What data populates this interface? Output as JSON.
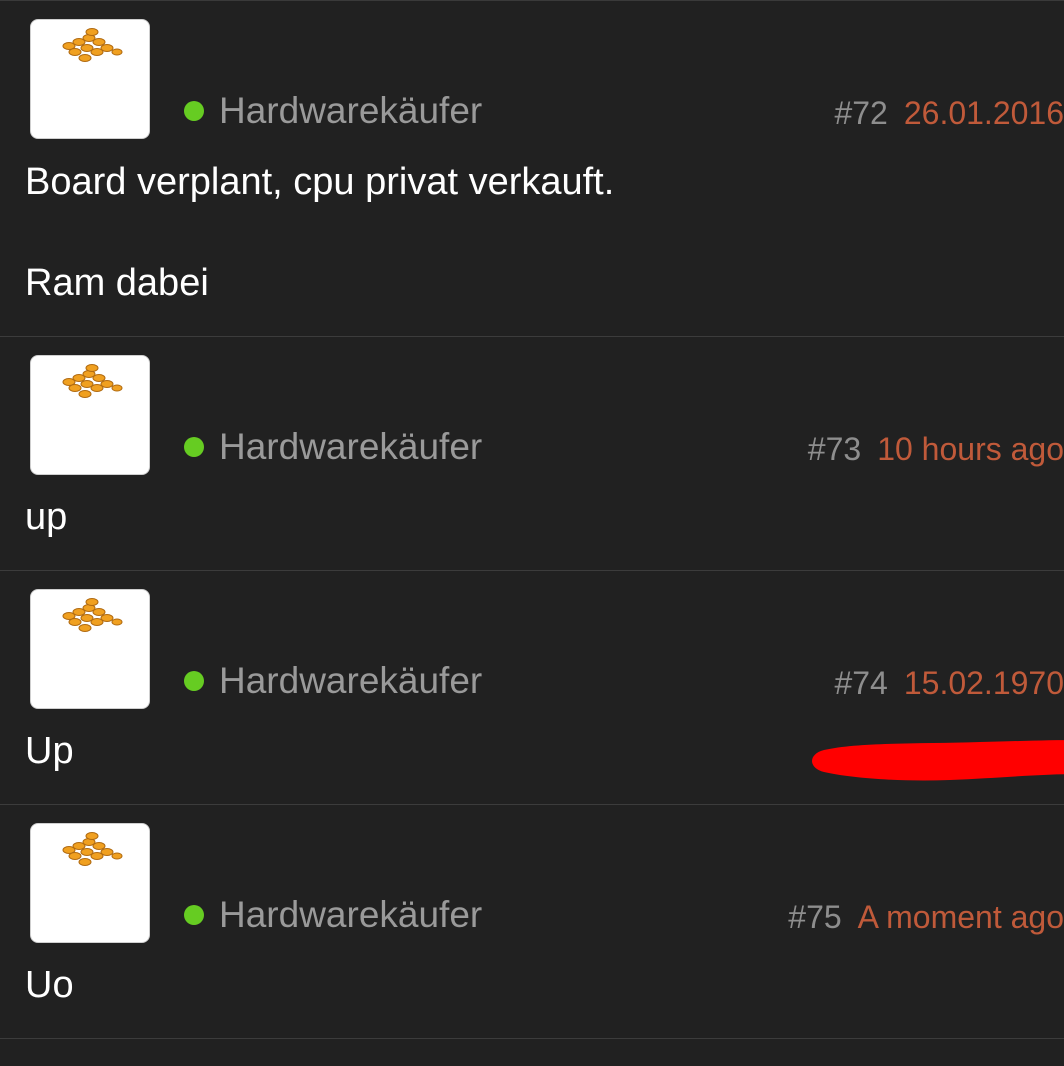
{
  "posts": [
    {
      "username": "Hardwarekäufer",
      "number": "#72",
      "time": "26.01.2016",
      "lines": [
        "Board verplant, cpu privat verkauft.",
        "Ram dabei"
      ]
    },
    {
      "username": "Hardwarekäufer",
      "number": "#73",
      "time": "10 hours ago",
      "lines": [
        "up"
      ]
    },
    {
      "username": "Hardwarekäufer",
      "number": "#74",
      "time": "15.02.1970",
      "lines": [
        "Up"
      ]
    },
    {
      "username": "Hardwarekäufer",
      "number": "#75",
      "time": "A moment ago",
      "lines": [
        "Uo"
      ]
    }
  ],
  "colors": {
    "background": "#212121",
    "online_dot": "#66cc22",
    "timestamp": "#c05a3a",
    "username": "#9a9a9a",
    "redaction": "#ff0000"
  },
  "icons": {
    "avatar": "gold-coins-icon",
    "status": "online-status-icon"
  }
}
